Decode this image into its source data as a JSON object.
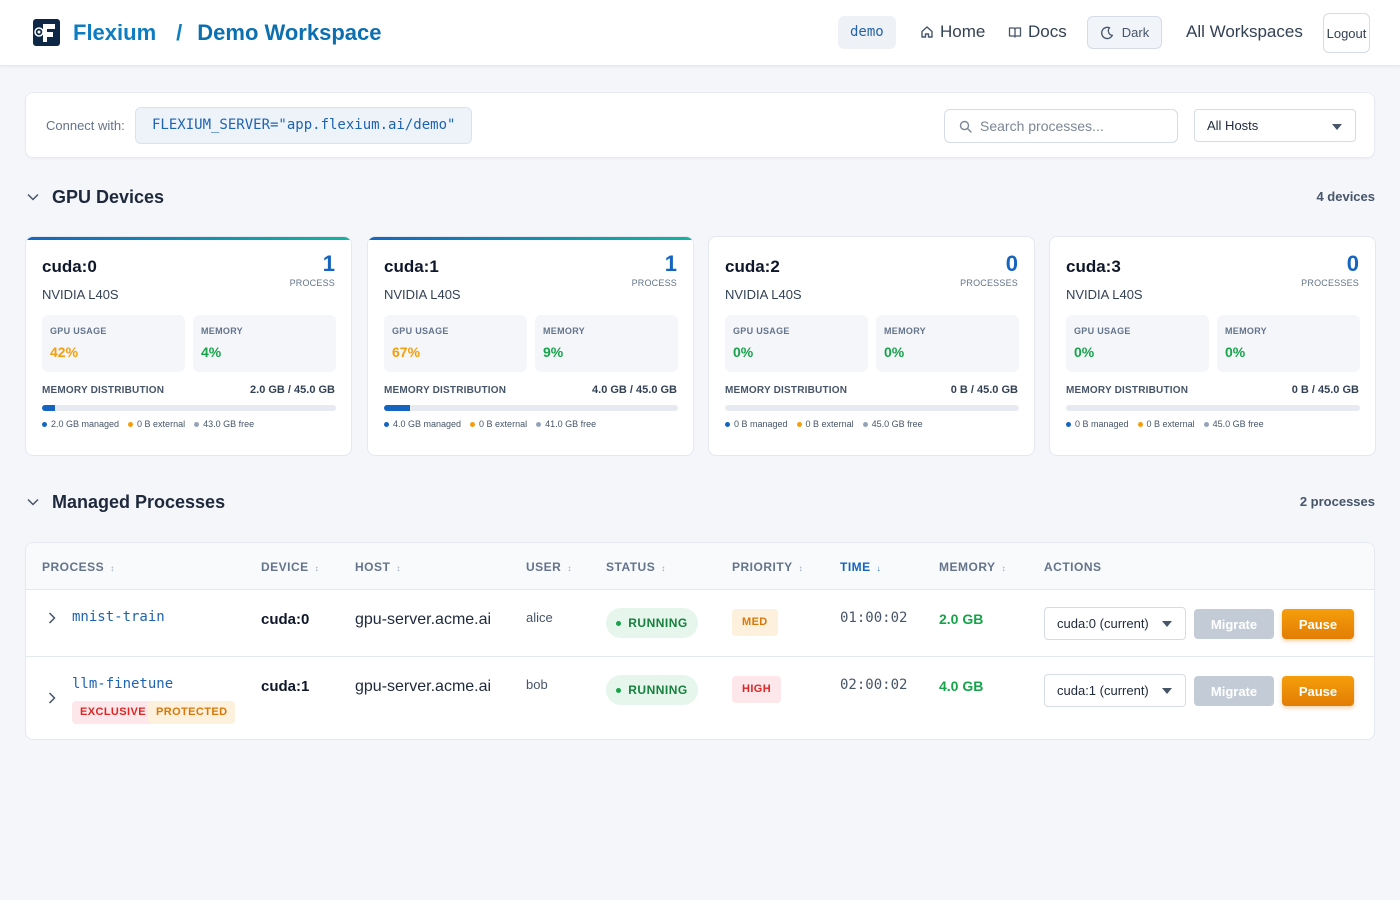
{
  "header": {
    "brand": "Flexium",
    "separator": "/",
    "workspace": "Demo Workspace",
    "workspace_badge": "demo",
    "nav": {
      "home": "Home",
      "docs": "Docs"
    },
    "theme_toggle": "Dark",
    "all_workspaces": "All Workspaces",
    "logout": "Logout"
  },
  "connect": {
    "label": "Connect with:",
    "command": "FLEXIUM_SERVER=\"app.flexium.ai/demo\"",
    "search_placeholder": "Search processes...",
    "host_filter": "All Hosts"
  },
  "gpu_section": {
    "title": "GPU Devices",
    "count": "4 devices",
    "metric_labels": {
      "gpu_usage": "GPU USAGE",
      "memory": "MEMORY",
      "distribution": "MEMORY DISTRIBUTION"
    },
    "devices": [
      {
        "name": "cuda:0",
        "model": "NVIDIA L40S",
        "process_count": "1",
        "process_label": "PROCESS",
        "gpu_usage": "42%",
        "memory": "4%",
        "dist_value": "2.0 GB / 45.0 GB",
        "managed_fraction": 0.044,
        "legend": {
          "managed": "2.0 GB managed",
          "external": "0 B external",
          "free": "43.0 GB free"
        }
      },
      {
        "name": "cuda:1",
        "model": "NVIDIA L40S",
        "process_count": "1",
        "process_label": "PROCESS",
        "gpu_usage": "67%",
        "memory": "9%",
        "dist_value": "4.0 GB / 45.0 GB",
        "managed_fraction": 0.089,
        "legend": {
          "managed": "4.0 GB managed",
          "external": "0 B external",
          "free": "41.0 GB free"
        }
      },
      {
        "name": "cuda:2",
        "model": "NVIDIA L40S",
        "process_count": "0",
        "process_label": "PROCESSES",
        "gpu_usage": "0%",
        "memory": "0%",
        "dist_value": "0 B / 45.0 GB",
        "managed_fraction": 0,
        "legend": {
          "managed": "0 B managed",
          "external": "0 B external",
          "free": "45.0 GB free"
        }
      },
      {
        "name": "cuda:3",
        "model": "NVIDIA L40S",
        "process_count": "0",
        "process_label": "PROCESSES",
        "gpu_usage": "0%",
        "memory": "0%",
        "dist_value": "0 B / 45.0 GB",
        "managed_fraction": 0,
        "legend": {
          "managed": "0 B managed",
          "external": "0 B external",
          "free": "45.0 GB free"
        }
      }
    ]
  },
  "process_section": {
    "title": "Managed Processes",
    "count": "2 processes",
    "columns": {
      "process": "PROCESS",
      "device": "DEVICE",
      "host": "HOST",
      "user": "USER",
      "status": "STATUS",
      "priority": "PRIORITY",
      "time": "TIME",
      "memory": "MEMORY",
      "actions": "ACTIONS"
    },
    "sort_glyph": "↕",
    "sorted_glyph": "↓",
    "rows": [
      {
        "name": "mnist-train",
        "device": "cuda:0",
        "host": "gpu-server.acme.ai",
        "user": "alice",
        "status": "RUNNING",
        "priority": "MED",
        "time": "01:00:02",
        "memory": "2.0 GB",
        "target": "cuda:0 (current)",
        "migrate": "Migrate",
        "pause": "Pause"
      },
      {
        "name": "llm-finetune",
        "device": "cuda:1",
        "host": "gpu-server.acme.ai",
        "user": "bob",
        "status": "RUNNING",
        "priority": "HIGH",
        "time": "02:00:02",
        "memory": "4.0 GB",
        "target": "cuda:1 (current)",
        "migrate": "Migrate",
        "pause": "Pause",
        "tags": [
          "EXCLUSIVE",
          "PROTECTED"
        ]
      }
    ]
  },
  "colors": {
    "accent": "#1565c0",
    "warning": "#f59e0b",
    "success": "#16a34a",
    "danger": "#dc2626"
  }
}
